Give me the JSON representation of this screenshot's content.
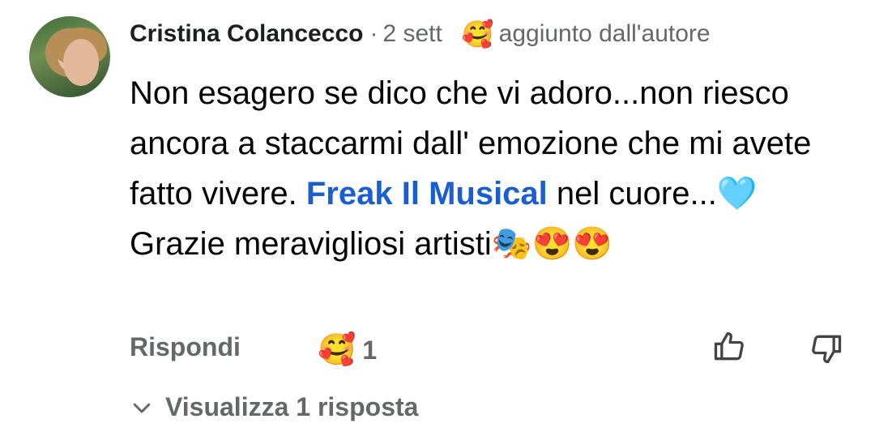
{
  "comment": {
    "author": "Cristina Colancecco",
    "separator": "·",
    "time": "2 sett",
    "badge_emoji": "🥰",
    "badge_text": "aggiunto dall'autore",
    "text_line1": "Non esagero se dico che vi adoro...non riesco ancora a staccarmi dall' emozione che mi avete fatto vivere. ",
    "mention": "Freak Il Musical",
    "text_line1_end": " nel cuore...🩵",
    "text_line2": "Grazie meravigliosi artisti🎭😍😍"
  },
  "actions": {
    "reply_label": "Rispondi",
    "reaction_emoji": "🥰",
    "reaction_count": "1"
  },
  "replies": {
    "label": "Visualizza 1 risposta"
  },
  "icons": {
    "like": "thumbs-up-icon",
    "dislike": "thumbs-down-icon",
    "chevron": "chevron-down-icon"
  },
  "colors": {
    "mention": "#1b5fcf",
    "secondary_text": "#65676b"
  }
}
